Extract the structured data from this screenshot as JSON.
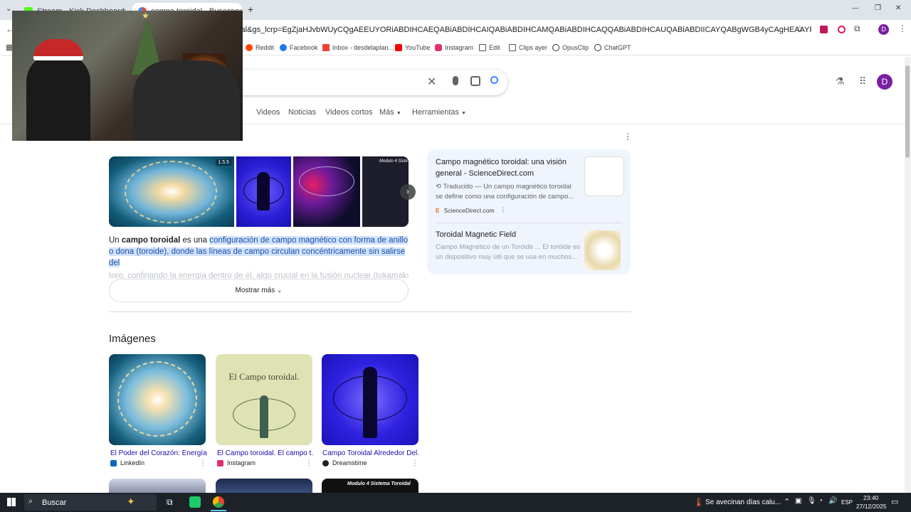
{
  "tabs": [
    {
      "title": "Stream - Kick Dashboard",
      "close": "×"
    },
    {
      "title": "campo toroidal - Buscar con G",
      "close": "×"
    }
  ],
  "new_tab": "+",
  "window_controls": {
    "minimize": "—",
    "restore": "❐",
    "close": "✕"
  },
  "address": "idal&gs_lcrp=EgZjaHJvbWUyCQgAEEUYORiABDIHCAEQABiABDIHCAIQABiABDIHCAMQABiABDIHCAQQABiABDIHCAUQABiABDIICAYQABgWGB4yCAgHEAAYFhgeMgoICBAAGAoYFhgeMg",
  "bookmarks": [
    "Reddit",
    "Facebook",
    "Inbox - desdelaplan...",
    "YouTube",
    "Instagram",
    "Edit",
    "Clips ayer",
    "OpusClip",
    "ChatGPT"
  ],
  "profile_letter": "D",
  "nav_tabs": [
    "Videos",
    "Noticias",
    "Videos cortos",
    "Más",
    "Herramientas"
  ],
  "overview": {
    "text_pre": "Un ",
    "text_bold": "campo toroidal",
    "text_mid": " es una ",
    "text_hl": "configuración de campo magnético con forma de anillo o dona (toroide), donde las líneas de campo circulan concéntricamente sin salirse del",
    "text_faded": "toro, confinando la energía dentro de él, algo crucial en la fusión nuclear (tokamaks",
    "show_more": "Mostrar más",
    "thumb_badge": "1.5.5",
    "thumb4_title": "Modulo 4 Siste"
  },
  "sources": [
    {
      "title": "Campo magnético toroidal: una visión general - ScienceDirect.com",
      "snippet": "Traducido — Un campo magnético toroidal se define como una configuración de campo...",
      "site": "ScienceDirect.com"
    },
    {
      "title": "Toroidal Magnetic Field",
      "snippet": "Campo Magnético de un Toróide ... El toróide es un dispositivo muy útil que se usa en muchos..."
    }
  ],
  "images_heading": "Imágenes",
  "images": [
    {
      "title": "El Poder del Corazón: Energía...",
      "source": "LinkedIn"
    },
    {
      "title": "El Campo toroidal. El campo t...",
      "source": "Instagram",
      "caption": "El Campo toroidal."
    },
    {
      "title": "Campo Toroidal Alrededor Del...",
      "source": "Dreamstime"
    }
  ],
  "images_row2_caption": "Modulo 4 Sistema Toroidal",
  "taskbar": {
    "search": "Buscar",
    "weather": "Se avecinan días calu...",
    "lang": "ESP",
    "time": "23:40",
    "date": "27/12/2025"
  },
  "colors": {
    "google_blue": "#1a0dab",
    "avatar": "#7b1fa2",
    "highlight": "#d3e3fd"
  }
}
